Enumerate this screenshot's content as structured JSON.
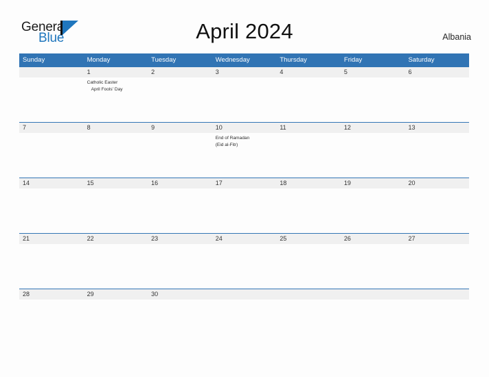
{
  "brand": {
    "name_top": "General",
    "name_bottom": "Blue",
    "mark": "triangle-logo-icon",
    "accent_color": "#1f76bd"
  },
  "header": {
    "title": "April 2024",
    "country": "Albania"
  },
  "colors": {
    "header_blue": "#3174b4",
    "date_band_gray": "#f0f0f0",
    "page_background": "#fdfdfd",
    "text_dark": "#333333"
  },
  "calendar": {
    "month": "April",
    "year": "2024",
    "weekdays": [
      "Sunday",
      "Monday",
      "Tuesday",
      "Wednesday",
      "Thursday",
      "Friday",
      "Saturday"
    ],
    "weeks": [
      {
        "days": [
          {
            "date": "",
            "events": []
          },
          {
            "date": "1",
            "events": [
              "Catholic Easter",
              "April Fools' Day"
            ]
          },
          {
            "date": "2",
            "events": []
          },
          {
            "date": "3",
            "events": []
          },
          {
            "date": "4",
            "events": []
          },
          {
            "date": "5",
            "events": []
          },
          {
            "date": "6",
            "events": []
          }
        ]
      },
      {
        "days": [
          {
            "date": "7",
            "events": []
          },
          {
            "date": "8",
            "events": []
          },
          {
            "date": "9",
            "events": []
          },
          {
            "date": "10",
            "events": [
              "End of Ramadan",
              "(Eid al-Fitr)"
            ]
          },
          {
            "date": "11",
            "events": []
          },
          {
            "date": "12",
            "events": []
          },
          {
            "date": "13",
            "events": []
          }
        ]
      },
      {
        "days": [
          {
            "date": "14",
            "events": []
          },
          {
            "date": "15",
            "events": []
          },
          {
            "date": "16",
            "events": []
          },
          {
            "date": "17",
            "events": []
          },
          {
            "date": "18",
            "events": []
          },
          {
            "date": "19",
            "events": []
          },
          {
            "date": "20",
            "events": []
          }
        ]
      },
      {
        "days": [
          {
            "date": "21",
            "events": []
          },
          {
            "date": "22",
            "events": []
          },
          {
            "date": "23",
            "events": []
          },
          {
            "date": "24",
            "events": []
          },
          {
            "date": "25",
            "events": []
          },
          {
            "date": "26",
            "events": []
          },
          {
            "date": "27",
            "events": []
          }
        ]
      },
      {
        "days": [
          {
            "date": "28",
            "events": []
          },
          {
            "date": "29",
            "events": []
          },
          {
            "date": "30",
            "events": []
          },
          {
            "date": "",
            "events": []
          },
          {
            "date": "",
            "events": []
          },
          {
            "date": "",
            "events": []
          },
          {
            "date": "",
            "events": []
          }
        ]
      }
    ]
  }
}
